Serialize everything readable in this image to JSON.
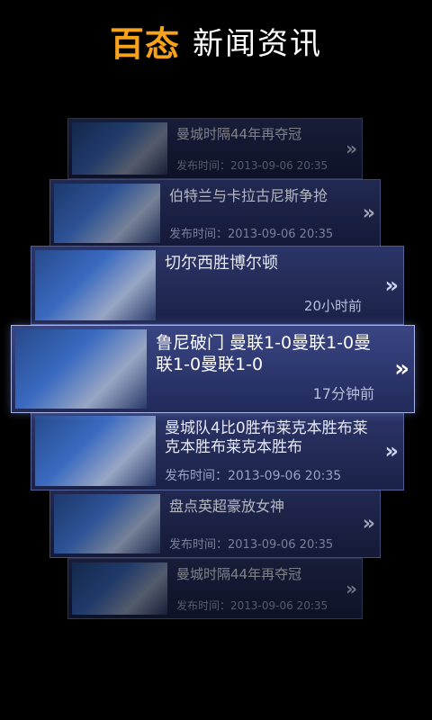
{
  "header": {
    "brand": "百态",
    "title": "新闻资讯"
  },
  "news": [
    {
      "headline": "曼城时隔44年再夺冠",
      "publish_label": "发布时间：2013-09-06 20:35",
      "thumb_icon": "news-thumb"
    },
    {
      "headline": "伯特兰与卡拉古尼斯争抢",
      "publish_label": "发布时间：2013-09-06 20:35",
      "thumb_icon": "news-thumb"
    },
    {
      "headline": "切尔西胜博尔顿",
      "time": "20小时前",
      "thumb_icon": "news-thumb"
    },
    {
      "headline": "鲁尼破门 曼联1-0曼联1-0曼联1-0曼联1-0",
      "time": "17分钟前",
      "thumb_icon": "news-thumb"
    },
    {
      "headline": "曼城队4比0胜布莱克本胜布莱克本胜布莱克本胜布",
      "publish_label": "发布时间：2013-09-06 20:35",
      "thumb_icon": "news-thumb"
    },
    {
      "headline": "盘点英超豪放女神",
      "publish_label": "发布时间：2013-09-06 20:35",
      "thumb_icon": "news-thumb"
    },
    {
      "headline": "曼城时隔44年再夺冠",
      "publish_label": "发布时间：2013-09-06 20:35",
      "thumb_icon": "news-thumb"
    }
  ],
  "chevron": "»",
  "colors": {
    "brand": "#f7a21b",
    "card": "#1b2147",
    "accent": "#aab6e6"
  }
}
